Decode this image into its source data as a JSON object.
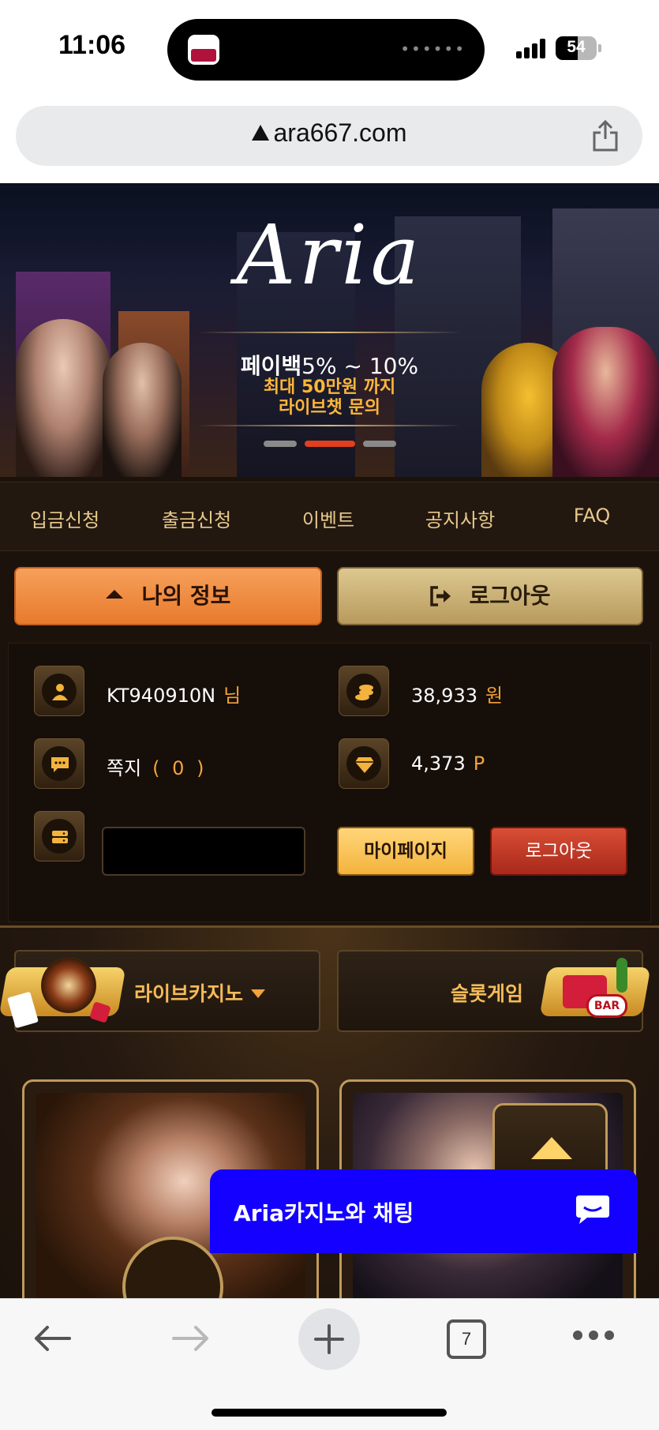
{
  "status_bar": {
    "time": "11:06",
    "battery": "54"
  },
  "browser": {
    "url": "ara667.com",
    "open_tabs": "7"
  },
  "banner": {
    "logo": "Aria",
    "promo_main": "페이백",
    "promo_range": "5% ~ 10%",
    "promo_line2": "최대 50만원 까지",
    "promo_line3": "라이브챗 문의",
    "slide_active": 2,
    "slide_count": 3
  },
  "nav": [
    "입금신청",
    "출금신청",
    "이벤트",
    "공지사항",
    "FAQ"
  ],
  "actions": {
    "my_info": "나의 정보",
    "logout": "로그아웃"
  },
  "account": {
    "username": "KT940910N",
    "username_suffix": "님",
    "balance": "38,933",
    "balance_unit": "원",
    "memo_label": "쪽지",
    "memo_count": "( 0 )",
    "points": "4,373",
    "points_unit": "P",
    "mypage_button": "마이페이지",
    "logout_button": "로그아웃"
  },
  "games": {
    "tab_live": "라이브카지노",
    "tab_slot": "슬롯게임"
  },
  "chat": {
    "label": "Aria카지노와 채팅"
  },
  "colors": {
    "accent_orange": "#f3a33a",
    "gold": "#e8c98c",
    "chat_blue": "#1400ff",
    "active_dot": "#e0401d"
  }
}
